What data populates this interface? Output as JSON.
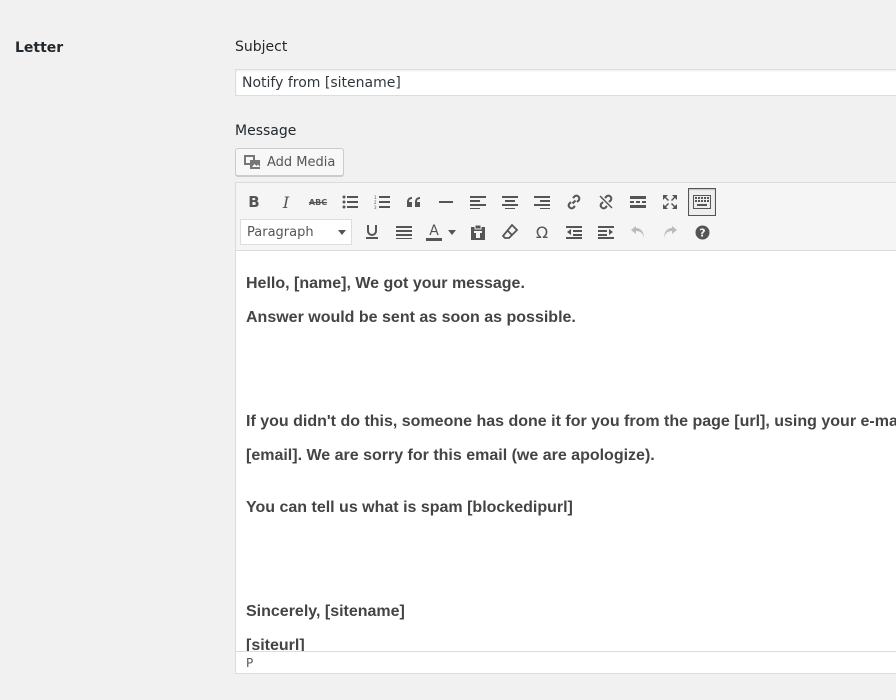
{
  "section": {
    "label": "Letter"
  },
  "subject": {
    "label": "Subject",
    "value": "Notify from [sitename]"
  },
  "message": {
    "label": "Message"
  },
  "add_media": {
    "label": "Add Media"
  },
  "toolbar": {
    "row1": [
      "bold-button",
      "italic-button",
      "strikethrough-button",
      "bullet-list-button",
      "numbered-list-button",
      "blockquote-button",
      "horizontal-rule-button",
      "align-left-button",
      "align-center-button",
      "align-right-button",
      "insert-link-button",
      "remove-link-button",
      "read-more-button",
      "fullscreen-button",
      "toolbar-toggle-button"
    ],
    "row2": [
      "format-select",
      "underline-button",
      "justify-button",
      "text-color-button",
      "paste-text-button",
      "clear-formatting-button",
      "special-character-button",
      "outdent-button",
      "indent-button",
      "undo-button",
      "redo-button",
      "help-button"
    ],
    "bold_label": "B",
    "italic_label": "I",
    "strike_label": "ABC",
    "text_color_label": "A",
    "omega_label": "Ω",
    "format_value": "Paragraph"
  },
  "content": {
    "lines": [
      "Hello, [name], We got your message.",
      "Answer would be sent as soon as possible.",
      "If you didn't do this, someone has done it for you from the page [url], using your e-mail",
      "[email]. We are sorry for this email (we are apologize).",
      "You can tell us what is spam [blockedipurl]",
      "Sincerely, [sitename]",
      "[siteurl]"
    ]
  },
  "statusbar": {
    "path": "P"
  },
  "colors": {
    "background": "#f1f1f1",
    "text": "#444444",
    "toolbar": "#f5f5f5"
  }
}
